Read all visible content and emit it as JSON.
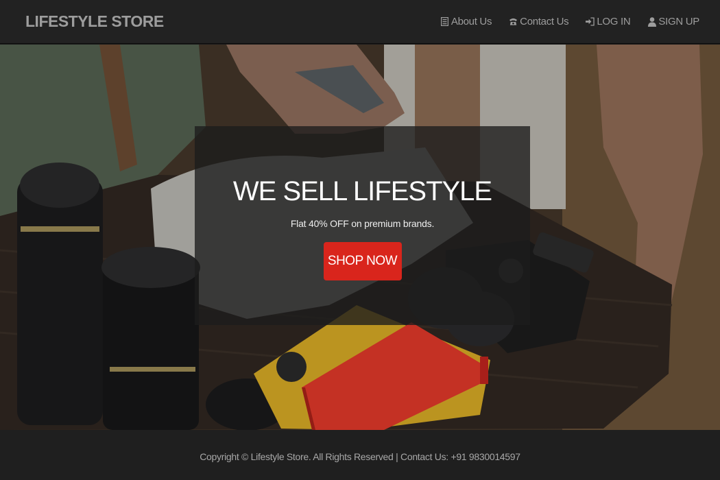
{
  "navbar": {
    "brand": "LIFESTYLE STORE",
    "links": [
      {
        "label": "About Us",
        "icon": "list-alt-icon"
      },
      {
        "label": "Contact Us",
        "icon": "phone-icon"
      },
      {
        "label": "LOG IN",
        "icon": "log-in-icon"
      },
      {
        "label": "SIGN UP",
        "icon": "user-icon"
      }
    ]
  },
  "hero": {
    "title": "WE SELL LIFESTYLE",
    "subtitle": "Flat 40% OFF on premium brands.",
    "cta_label": "SHOP NOW"
  },
  "footer": {
    "text": "Copyright © Lifestyle Store. All Rights Reserved | Contact Us: +91 9830014597"
  },
  "colors": {
    "navbar_bg": "#222222",
    "nav_text": "#9d9d9d",
    "cta_bg": "#d9251c",
    "footer_bg": "#1f1f1f"
  }
}
